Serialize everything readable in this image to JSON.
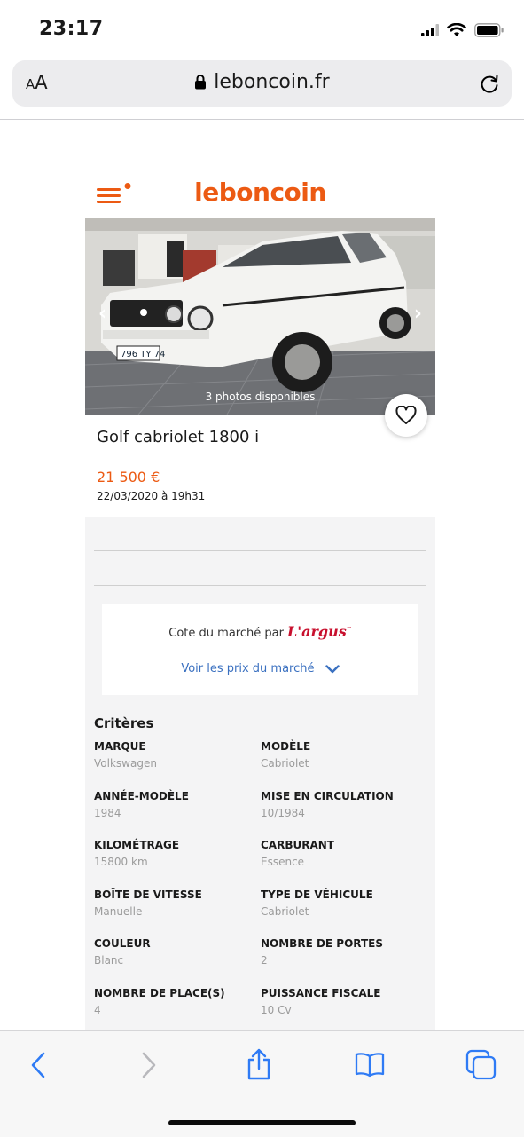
{
  "status_bar": {
    "time": "23:17"
  },
  "browser": {
    "aa_label": "AA",
    "domain": "leboncoin.fr"
  },
  "site": {
    "logo": "leboncoin"
  },
  "listing": {
    "photos_label": "3 photos disponibles",
    "title": "Golf cabriolet 1800 i",
    "price": "21 500 €",
    "date": "22/03/2020 à 19h31"
  },
  "market": {
    "cote_label": "Cote du marché par",
    "brand": "L'argus",
    "brand_tm": "™",
    "link_label": "Voir les prix du marché"
  },
  "criteres": {
    "title": "Critères",
    "rows": [
      [
        {
          "label": "MARQUE",
          "value": "Volkswagen"
        },
        {
          "label": "MODÈLE",
          "value": "Cabriolet"
        }
      ],
      [
        {
          "label": "ANNÉE-MODÈLE",
          "value": "1984"
        },
        {
          "label": "MISE EN CIRCULATION",
          "value": "10/1984"
        }
      ],
      [
        {
          "label": "KILOMÉTRAGE",
          "value": "15800 km"
        },
        {
          "label": "CARBURANT",
          "value": "Essence"
        }
      ],
      [
        {
          "label": "BOÎTE DE VITESSE",
          "value": "Manuelle"
        },
        {
          "label": "TYPE DE VÉHICULE",
          "value": "Cabriolet"
        }
      ],
      [
        {
          "label": "COULEUR",
          "value": "Blanc"
        },
        {
          "label": "NOMBRE DE PORTES",
          "value": "2"
        }
      ],
      [
        {
          "label": "NOMBRE DE PLACE(S)",
          "value": "4"
        },
        {
          "label": "PUISSANCE FISCALE",
          "value": "10 Cv"
        }
      ]
    ]
  },
  "colors": {
    "accent": "#ec5a13",
    "link": "#3a70c0",
    "argus": "#c8102e"
  },
  "icons": [
    "signal-icon",
    "wifi-icon",
    "battery-icon",
    "lock-icon",
    "reload-icon",
    "menu-icon",
    "heart-icon",
    "chevron-down-icon",
    "back-icon",
    "forward-icon",
    "share-icon",
    "bookmarks-icon",
    "tabs-icon"
  ]
}
